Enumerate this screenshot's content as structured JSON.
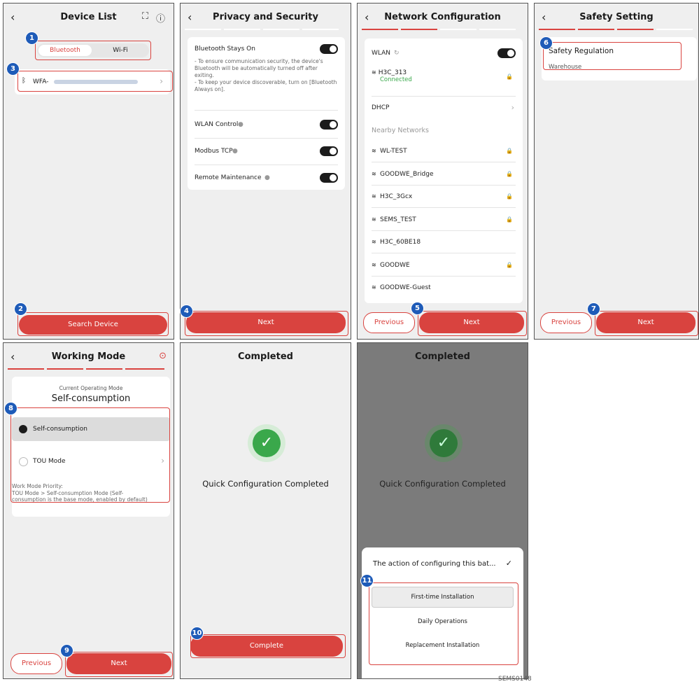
{
  "colors": {
    "accent": "#d9433f",
    "badge": "#1e5bb8",
    "success": "#3aa84b"
  },
  "badges": [
    "1",
    "2",
    "3",
    "4",
    "5",
    "6",
    "7",
    "8",
    "9",
    "10",
    "11"
  ],
  "device_list": {
    "title": "Device List",
    "tabs": [
      "Bluetooth",
      "Wi-Fi"
    ],
    "device": "WFA-",
    "search_button": "Search Device"
  },
  "privacy": {
    "title": "Privacy and Security",
    "bt_label": "Bluetooth Stays On",
    "bt_desc": "- To ensure communication security, the device's Bluetooth will be automatically turned off after exiting.\n- To keep your device discoverable, turn on [Bluetooth Always on].",
    "wlan": "WLAN Control",
    "modbus": "Modbus TCP",
    "remote": "Remote Maintenance",
    "next": "Next"
  },
  "network": {
    "title": "Network Configuration",
    "wlan": "WLAN",
    "connected_ssid": "H3C_313",
    "connected_status": "Connected",
    "dhcp": "DHCP",
    "nearby": "Nearby Networks",
    "networks": [
      {
        "ssid": "WL-TEST",
        "locked": true
      },
      {
        "ssid": "GOODWE_Bridge",
        "locked": true
      },
      {
        "ssid": "H3C_3Gcx",
        "locked": true
      },
      {
        "ssid": "SEMS_TEST",
        "locked": true
      },
      {
        "ssid": "H3C_60BE18",
        "locked": false
      },
      {
        "ssid": "GOODWE",
        "locked": true
      },
      {
        "ssid": "GOODWE-Guest",
        "locked": false
      }
    ],
    "previous": "Previous",
    "next": "Next"
  },
  "safety": {
    "title": "Safety Setting",
    "label": "Safety Regulation",
    "value": "Warehouse",
    "previous": "Previous",
    "next": "Next"
  },
  "working": {
    "title": "Working Mode",
    "current_label": "Current Operating Mode",
    "current_value": "Self-consumption",
    "option1": "Self-consumption",
    "option2": "TOU Mode",
    "priority": "Work Mode Priority:\nTOU Mode > Self-consumption Mode (Self-consumption is the base mode, enabled by default)",
    "previous": "Previous",
    "next": "Next"
  },
  "completed": {
    "title": "Completed",
    "message": "Quick Configuration Completed",
    "button": "Complete"
  },
  "completed_sheet": {
    "title": "Completed",
    "message": "Quick Configuration Completed",
    "question": "The action of configuring this bat...",
    "options": [
      "First-time Installation",
      "Daily Operations",
      "Replacement Installation"
    ]
  },
  "figure_code": "SEMS0148"
}
